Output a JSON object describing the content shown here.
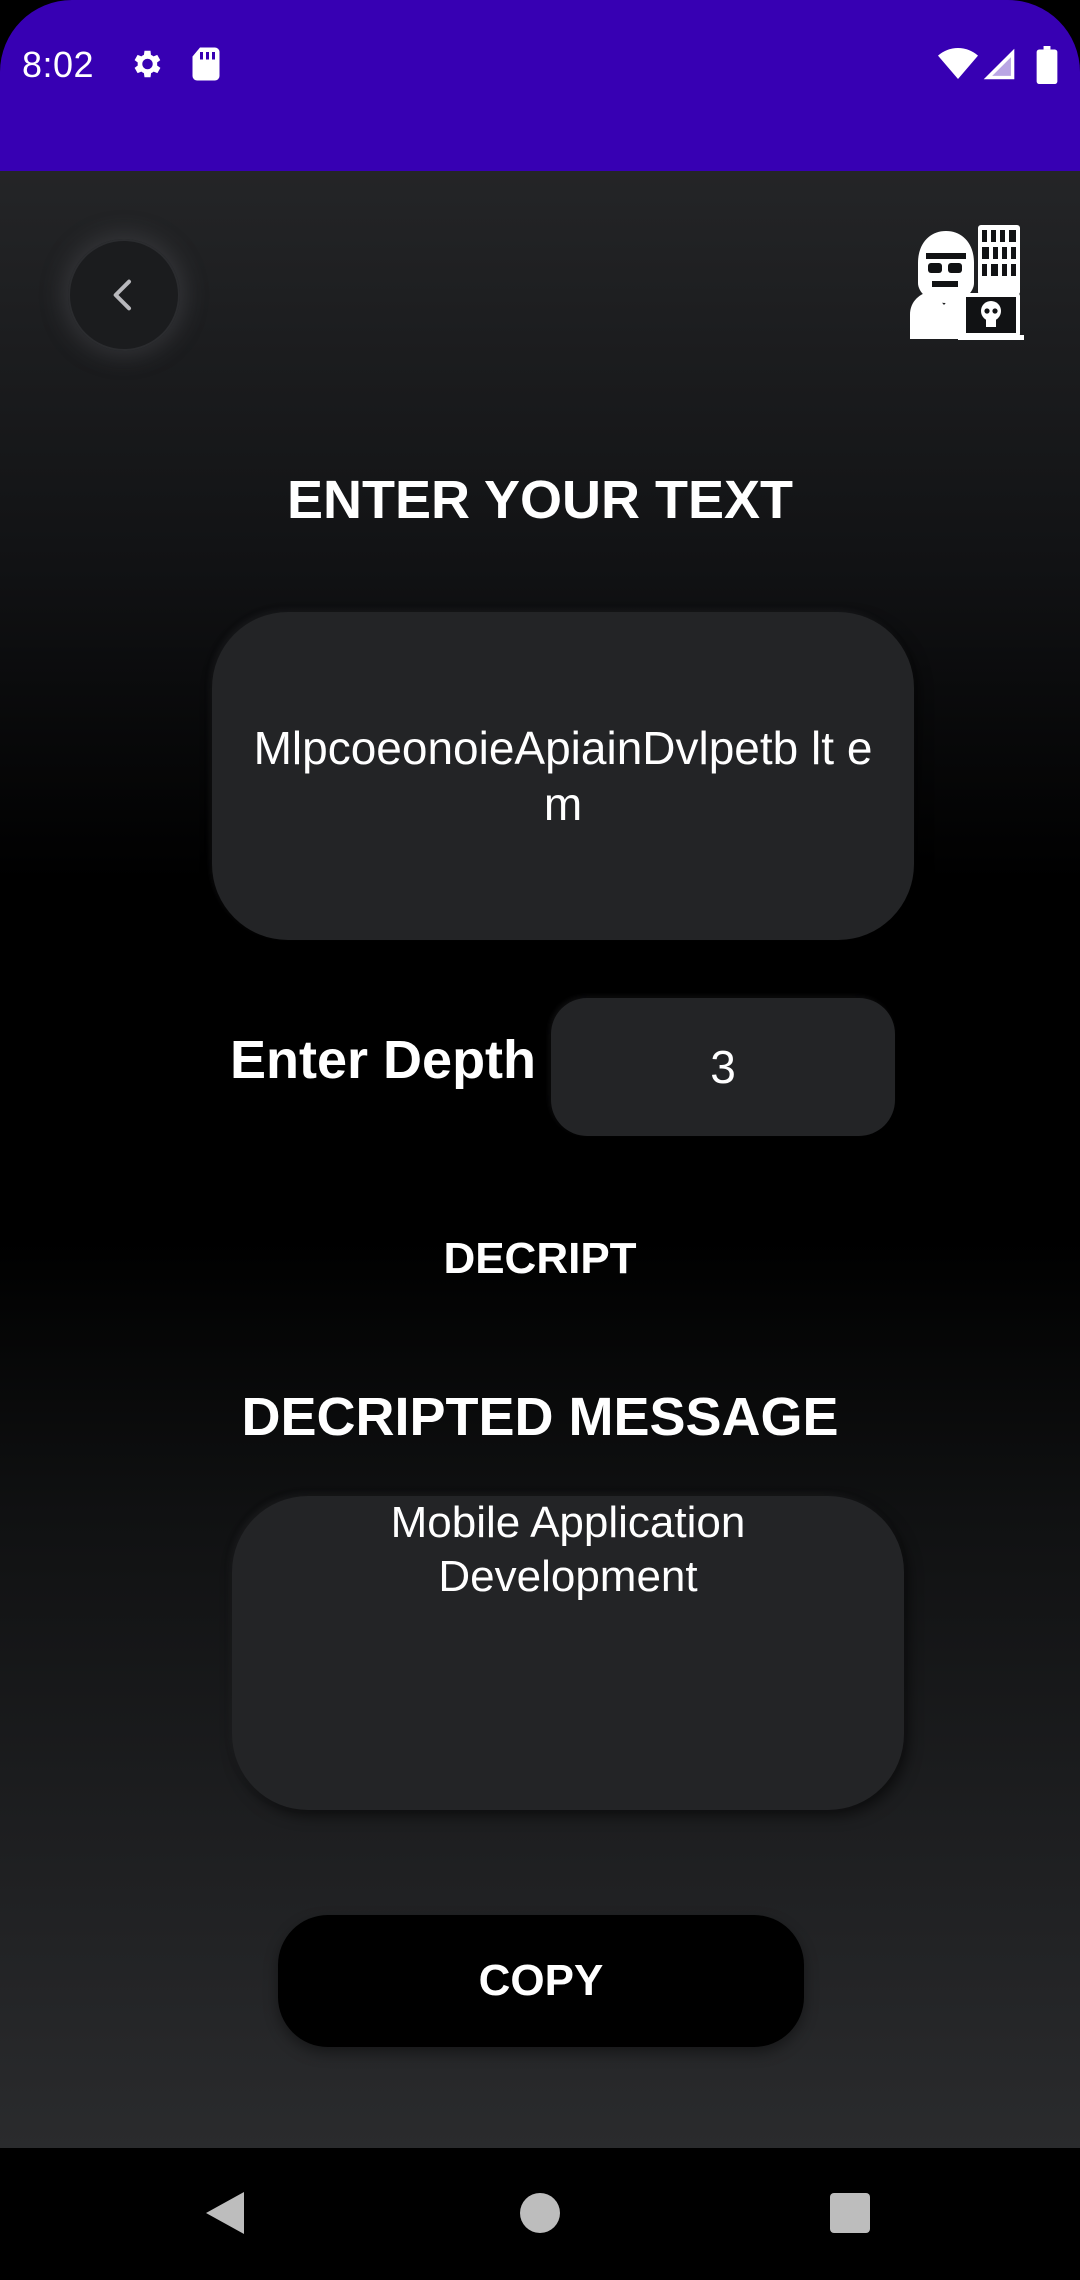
{
  "status_bar": {
    "time": "8:02",
    "icons": [
      "gear-icon",
      "sd-card-icon",
      "wifi-icon",
      "cellular-signal-icon",
      "battery-icon"
    ]
  },
  "header": {
    "back_icon": "chevron-left-icon",
    "logo_icon": "hacker-logo-icon"
  },
  "input_section": {
    "title": "ENTER YOUR TEXT",
    "text_value": "MlpcoeonoieApiainDvlpetb lt em"
  },
  "depth": {
    "label": "Enter Depth",
    "value": "3"
  },
  "actions": {
    "decrypt_label": "DECRIPT",
    "copy_label": "COPY"
  },
  "output_section": {
    "title": "DECRIPTED MESSAGE",
    "message": "Mobile Application Development"
  },
  "nav_bar": {
    "icons": [
      "back-triangle-icon",
      "home-circle-icon",
      "recents-square-icon"
    ]
  },
  "colors": {
    "status_bar": "#3700b3",
    "field_background": "#232426",
    "text": "#ffffff"
  }
}
